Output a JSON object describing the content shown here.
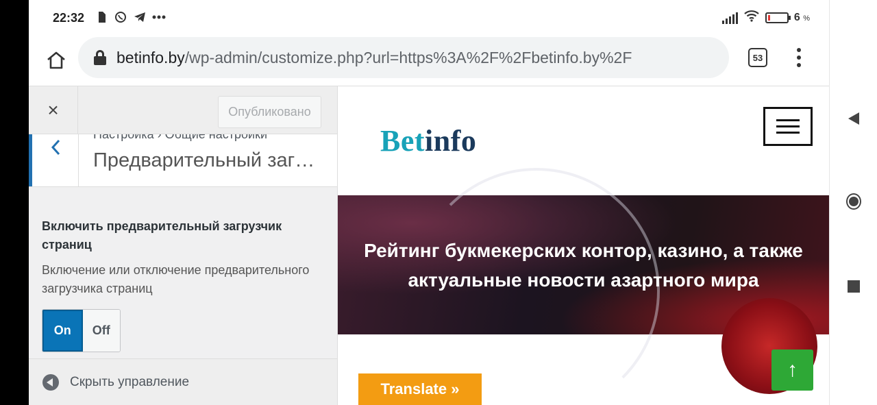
{
  "status_bar": {
    "time": "22:32",
    "battery_percent": "6",
    "battery_unit": "%"
  },
  "browser": {
    "url_host": "betinfo.by",
    "url_path": "/wp-admin/customize.php?url=https%3A%2F%2Fbetinfo.by%2F",
    "tab_count": "53"
  },
  "customizer": {
    "close_label": "×",
    "publish_label": "Опубликовано",
    "breadcrumb": "Настройка › Общие настройки",
    "section_title": "Предварительный загрузчик страниц",
    "setting_label": "Включить предварительный загрузчик страниц",
    "setting_description": "Включение или отключение предварительного загрузчика страниц",
    "toggle_on": "On",
    "toggle_off": "Off",
    "toggle_state": "on",
    "collapse_label": "Скрыть управление"
  },
  "preview": {
    "logo_part1": "Bet",
    "logo_part2": "info",
    "hero_text": "Рейтинг букмекерских контор, казино, а также актуальные новости азартного мира",
    "translate_label": "Translate »",
    "scroll_top_label": "↑"
  },
  "colors": {
    "accent": "#2271b1",
    "toggle_on": "#0a74b7",
    "translate": "#f39c12",
    "scroll_top": "#2ea836",
    "logo_teal": "#18a2b8",
    "logo_navy": "#1b3a5c"
  }
}
